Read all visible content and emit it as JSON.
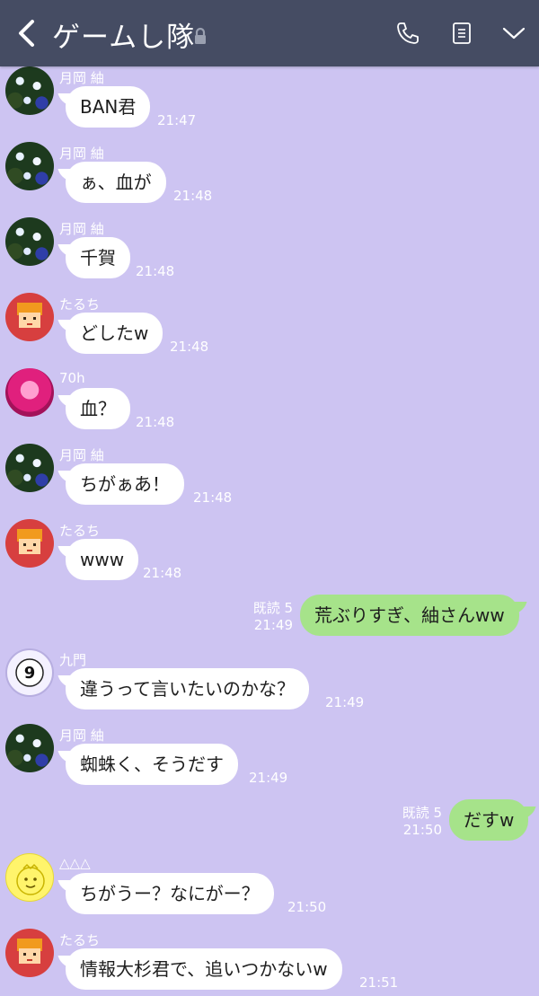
{
  "header": {
    "back_icon": "chevron-left-icon",
    "title": "ゲームし隊",
    "lock_icon": "lock-icon",
    "actions": [
      "phone-icon",
      "notes-icon",
      "chevron-down-icon"
    ],
    "bg_color": "#454c63"
  },
  "chat": {
    "bg_color": "#cdc4f2",
    "outgoing_bubble_color": "#a6e38a",
    "messages": [
      {
        "sender": "月岡 紬",
        "text": "BAN君",
        "time": "21:47"
      },
      {
        "sender": "月岡 紬",
        "text": "ぁ、血が",
        "time": "21:48"
      },
      {
        "sender": "月岡 紬",
        "text": "千賀",
        "time": "21:48"
      },
      {
        "sender": "たるち",
        "text": "どしたw",
        "time": "21:48"
      },
      {
        "sender": "70h",
        "text": "血？",
        "time": "21:48"
      },
      {
        "sender": "月岡 紬",
        "text": "ちがぁあ！",
        "time": "21:48"
      },
      {
        "sender": "たるち",
        "text": "www",
        "time": "21:48"
      },
      {
        "outgoing": true,
        "read": "既読 5",
        "text": "荒ぶりすぎ、紬さんww",
        "time": "21:49"
      },
      {
        "sender": "九門",
        "avatar_text": "9",
        "text": "違うって言いたいのかな？",
        "time": "21:49"
      },
      {
        "sender": "月岡 紬",
        "text": "蜘蛛く、そうだす",
        "time": "21:49"
      },
      {
        "outgoing": true,
        "read": "既読 5",
        "text": "だすw",
        "time": "21:50"
      },
      {
        "sender": "△△△",
        "text": "ちがうー？なにがー？",
        "time": "21:50"
      },
      {
        "sender": "たるち",
        "text": "情報大杉君で、追いつかないw",
        "time": "21:51"
      }
    ]
  }
}
